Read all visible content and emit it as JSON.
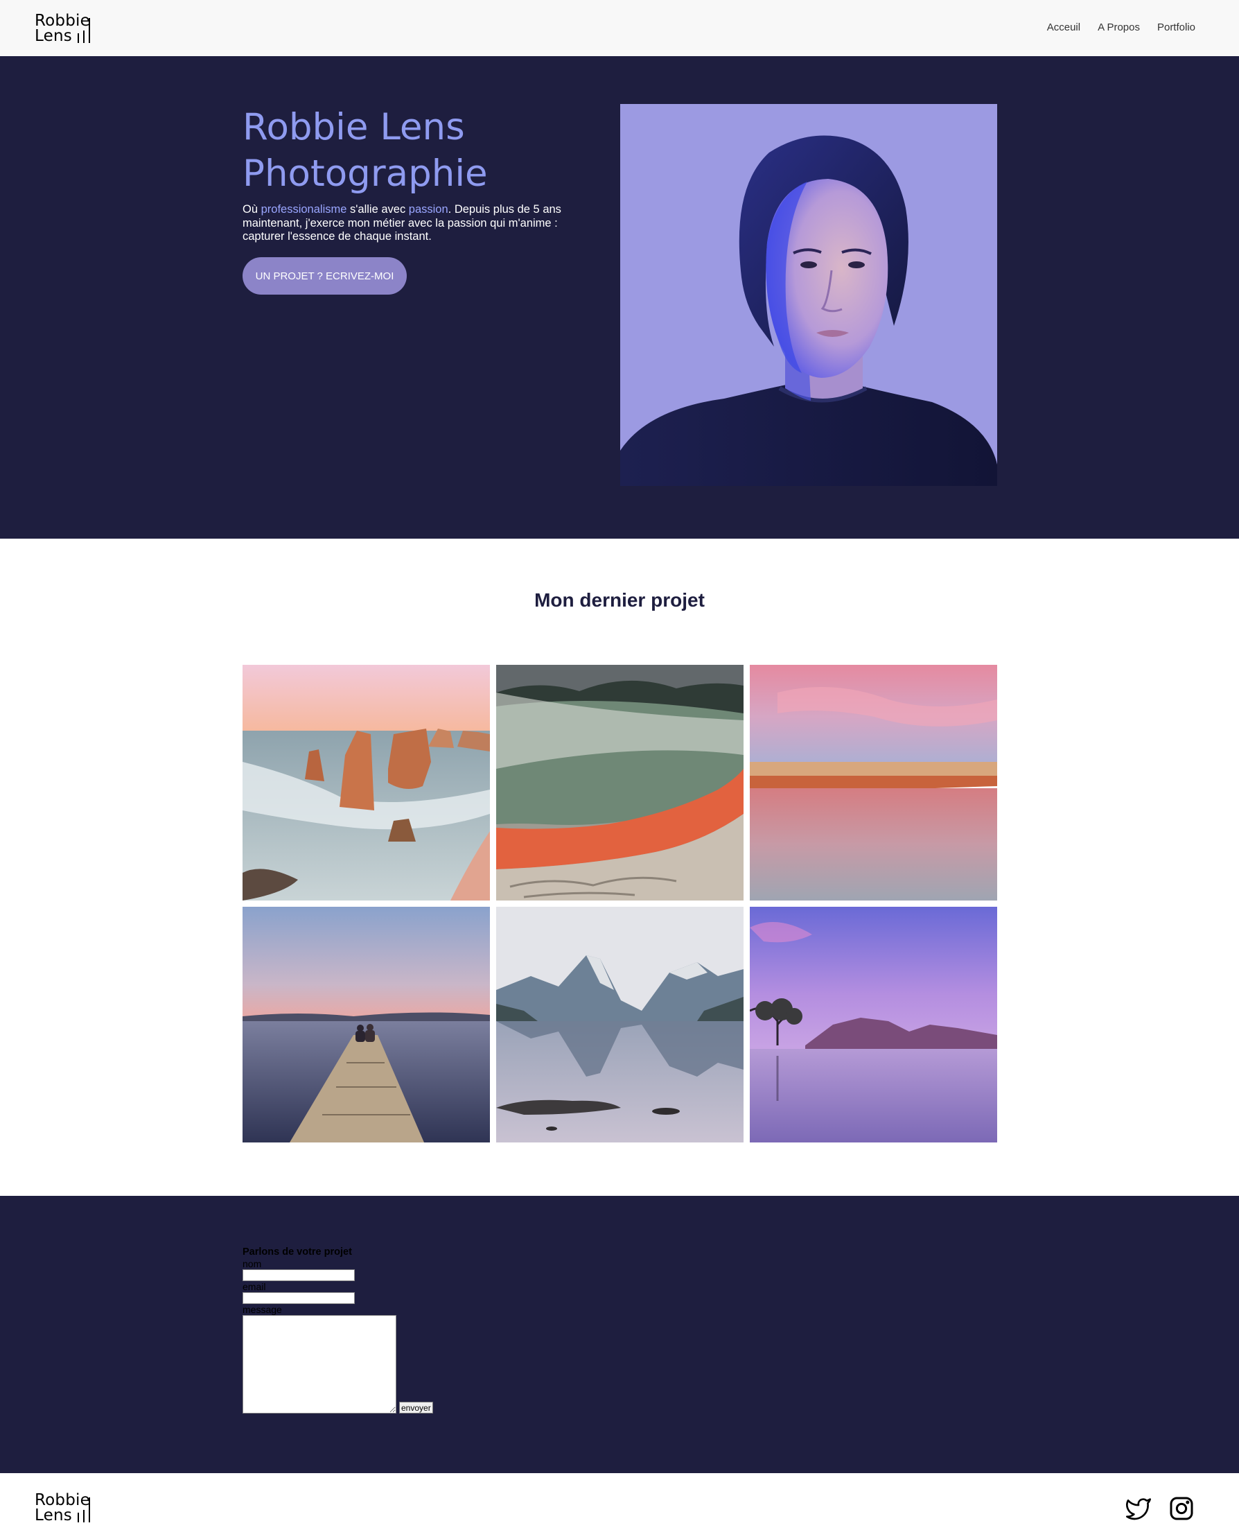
{
  "header": {
    "logo": {
      "line1": "Robbie",
      "line2": "Lens"
    },
    "nav": [
      {
        "label": "Acceuil"
      },
      {
        "label": "A Propos"
      },
      {
        "label": "Portfolio"
      }
    ]
  },
  "hero": {
    "title_line1": "Robbie Lens",
    "title_line2": "Photographie",
    "text": {
      "p1": "Où ",
      "highlight1": "professionalisme",
      "p2": " s'allie avec ",
      "highlight2": "passion",
      "p3": ". Depuis plus de 5 ans maintenant, j'exerce mon métier avec la passion qui m'anime : capturer l'essence de chaque instant."
    },
    "cta_label": "UN PROJET ? ECRIVEZ-MOI",
    "portrait_icon": "portrait-photo"
  },
  "project": {
    "title": "Mon dernier projet",
    "tiles": [
      {
        "icon": "sea-stacks-photo"
      },
      {
        "icon": "hot-spring-photo"
      },
      {
        "icon": "pink-beach-photo"
      },
      {
        "icon": "pier-couple-photo"
      },
      {
        "icon": "mountain-reflection-photo"
      },
      {
        "icon": "lake-tree-photo"
      }
    ]
  },
  "contact": {
    "title": "Parlons de votre projet",
    "name_label": "nom",
    "email_label": "email",
    "message_label": "message",
    "send_label": "envoyer"
  },
  "footer": {
    "logo": {
      "line1": "Robbie",
      "line2": "Lens"
    },
    "social": [
      {
        "icon": "twitter-icon"
      },
      {
        "icon": "instagram-icon"
      }
    ]
  },
  "colors": {
    "navy": "#1e1e3f",
    "accent": "#8f9bf0",
    "button": "#8c84c8",
    "header_bg": "#f8f8f8"
  }
}
